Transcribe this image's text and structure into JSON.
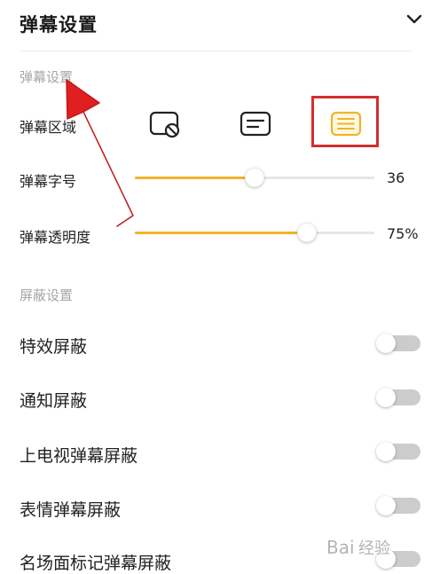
{
  "header": {
    "title": "弹幕设置"
  },
  "display_section": {
    "title": "弹幕设置",
    "area_label": "弹幕区域",
    "area_options": [
      "block-icon",
      "lines-icon",
      "list-icon"
    ],
    "area_selected_index": 2,
    "font_size": {
      "label": "弹幕字号",
      "value_text": "36",
      "fill_fraction": 0.5
    },
    "opacity": {
      "label": "弹幕透明度",
      "value_text": "75%",
      "fill_fraction": 0.72
    }
  },
  "block_section": {
    "title": "屏蔽设置",
    "items": [
      {
        "label": "特效屏蔽",
        "on": false
      },
      {
        "label": "通知屏蔽",
        "on": false
      },
      {
        "label": "上电视弹幕屏蔽",
        "on": false
      },
      {
        "label": "表情弹幕屏蔽",
        "on": false
      },
      {
        "label": "名场面标记弹幕屏蔽",
        "on": false
      }
    ]
  },
  "watermark": {
    "text": "Bai 经验"
  },
  "colors": {
    "accent": "#f0b429",
    "highlight": "#d32f2f",
    "arrow": "#e02020"
  }
}
